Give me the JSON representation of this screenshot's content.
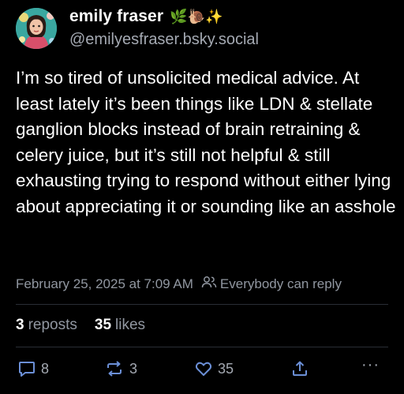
{
  "author": {
    "display_name": "emily fraser",
    "name_emojis": "🌿🐌✨",
    "handle": "@emilyesfraser.bsky.social"
  },
  "post": {
    "text": "I’m so tired of unsolicited medical advice. At least lately it’s been things like LDN & stellate ganglion blocks instead of brain retraining & celery juice, but it’s still not helpful & still exhausting trying to respond without either lying about appreciating it or sounding like an asshole",
    "timestamp": "February 25, 2025 at 7:09 AM",
    "reply_setting": "Everybody can reply"
  },
  "stats": {
    "reposts_count": "3",
    "reposts_label": "reposts",
    "likes_count": "35",
    "likes_label": "likes"
  },
  "actions": {
    "reply_count": "8",
    "repost_count": "3",
    "like_count": "35",
    "more_label": "···"
  },
  "colors": {
    "background": "#000000",
    "text": "#ffffff",
    "secondary_text": "#9197a1",
    "divider": "#2a2e35",
    "accent_icons": "#6b8fd6"
  },
  "icons": {
    "reply": "speech-bubble-icon",
    "repost": "repost-arrows-icon",
    "like": "heart-icon",
    "share": "share-up-arrow-icon",
    "more": "ellipsis-icon",
    "reply_setting": "people-icon"
  }
}
